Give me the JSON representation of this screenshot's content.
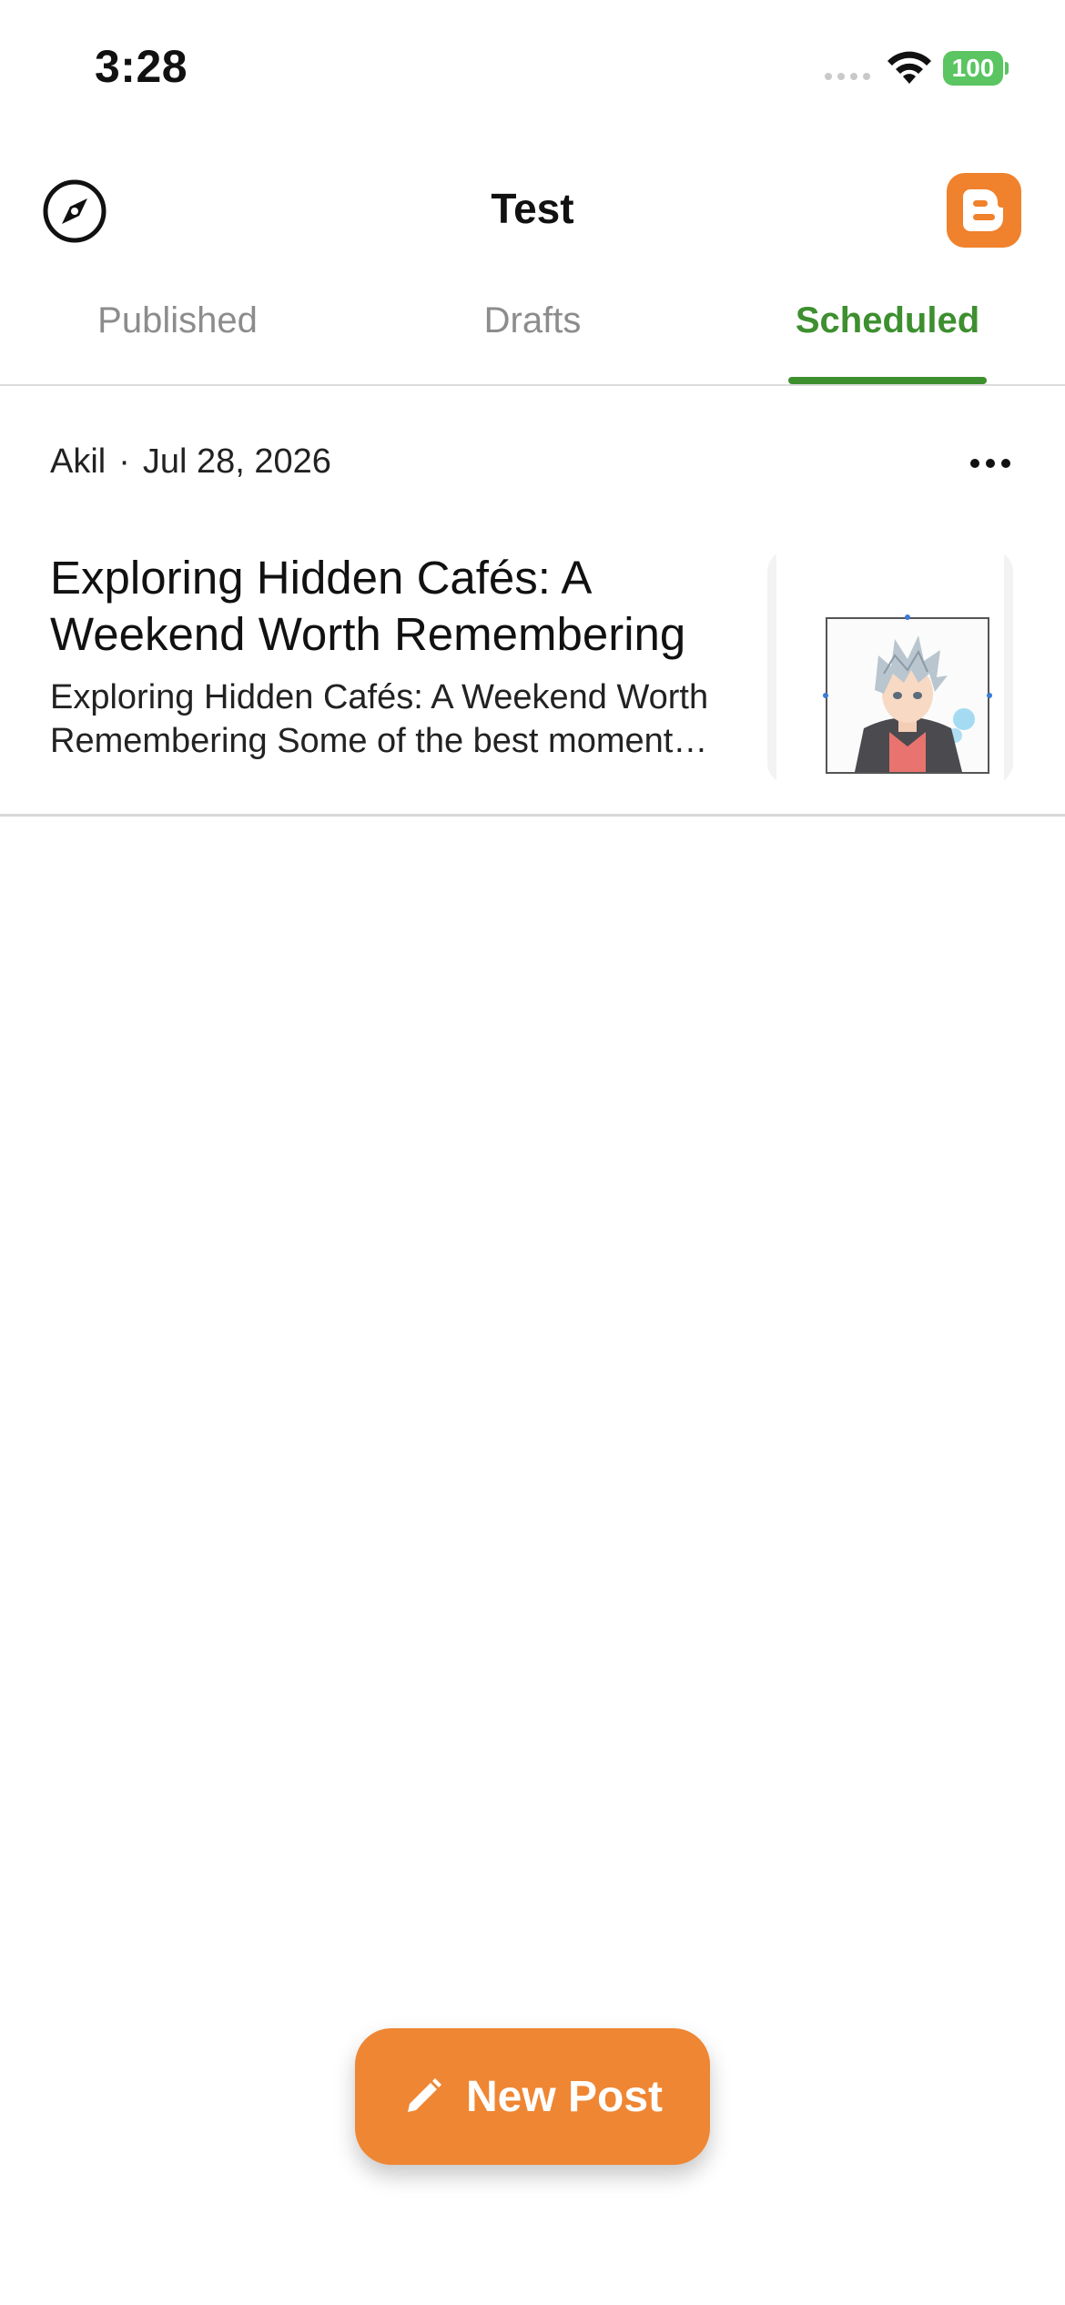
{
  "status_bar": {
    "time": "3:28",
    "battery": "100"
  },
  "header": {
    "title": "Test",
    "left_icon": "compass-icon",
    "right_icon": "blogger-icon",
    "brand_color": "#f0812d"
  },
  "tabs": [
    {
      "label": "Published",
      "selected": false
    },
    {
      "label": "Drafts",
      "selected": false
    },
    {
      "label": "Scheduled",
      "selected": true
    }
  ],
  "accent_color": "#3d8f2f",
  "posts": [
    {
      "author": "Akil",
      "separator": "·",
      "date": "Jul 28, 2026",
      "title": "Exploring Hidden Cafés: A Weekend Worth Remembering",
      "excerpt": "Exploring Hidden Cafés: A Weekend Worth Remembering Some of the best moments happen in quiet little corners of the city.",
      "menu_icon": "more-horizontal-icon",
      "thumbnail": "anime-character-thumbnail"
    }
  ],
  "fab": {
    "label": "New Post",
    "icon": "pencil-icon",
    "color": "#ef8633"
  }
}
